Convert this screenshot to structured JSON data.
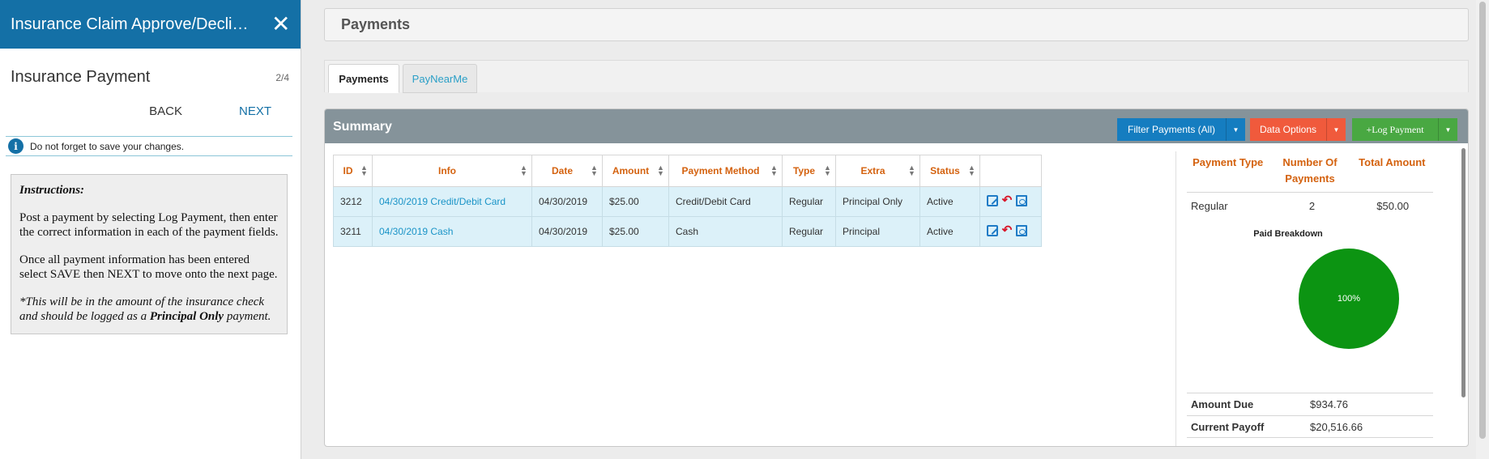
{
  "left_panel": {
    "header_title": "Insurance Claim Approve/Decli…",
    "close_glyph": "✕",
    "step_title": "Insurance Payment",
    "step_count": "2/4",
    "back_label": "BACK",
    "next_label": "NEXT",
    "notice": "Do not forget to save your changes.",
    "instructions": {
      "title": "Instructions:",
      "p1": "Post a payment by selecting Log Payment, then enter the correct information in each of the payment fields.",
      "p2": "Once all payment information has been entered select SAVE then NEXT to move onto the next page.",
      "p3_prefix": "*This will be in the amount of the insurance check and should be logged as a ",
      "p3_bold": "Principal Only",
      "p3_suffix": " payment."
    }
  },
  "page_title": "Payments",
  "tabs": [
    {
      "label": "Payments",
      "active": true
    },
    {
      "label": "PayNearMe",
      "active": false
    }
  ],
  "summary_panel": {
    "title": "Summary",
    "buttons": {
      "filter": "Filter Payments (All)",
      "data_options": "Data Options",
      "log_payment": "+Log Payment"
    }
  },
  "table": {
    "columns": [
      "ID",
      "Info",
      "Date",
      "Amount",
      "Payment Method",
      "Type",
      "Extra",
      "Status",
      ""
    ],
    "rows": [
      [
        "3212",
        "04/30/2019 Credit/Debit Card",
        "04/30/2019",
        "$25.00",
        "Credit/Debit Card",
        "Regular",
        "Principal Only",
        "Active"
      ],
      [
        "3211",
        "04/30/2019 Cash",
        "04/30/2019",
        "$25.00",
        "Cash",
        "Regular",
        "Principal",
        "Active"
      ]
    ],
    "row_actions": [
      "edit-icon",
      "undo-icon",
      "pdf-icon"
    ]
  },
  "breakdown": {
    "headers": [
      "Payment Type",
      "Number Of Payments",
      "Total Amount"
    ],
    "rows": [
      [
        "Regular",
        "2",
        "$50.00"
      ]
    ],
    "pie_title": "Paid Breakdown",
    "pie_label": "100%",
    "pie_color": "#0c9412",
    "amount_due_label": "Amount Due",
    "amount_due": "$934.76",
    "current_payoff_label": "Current Payoff",
    "current_payoff": "$20,516.66"
  },
  "colors": {
    "header_blue": "#1470a6",
    "header_orange": "#d4620f",
    "link_blue": "#1a94c7",
    "filter_button": "#157dc0",
    "data_options_button": "#f05a3c",
    "log_payment_button": "#49a842"
  }
}
